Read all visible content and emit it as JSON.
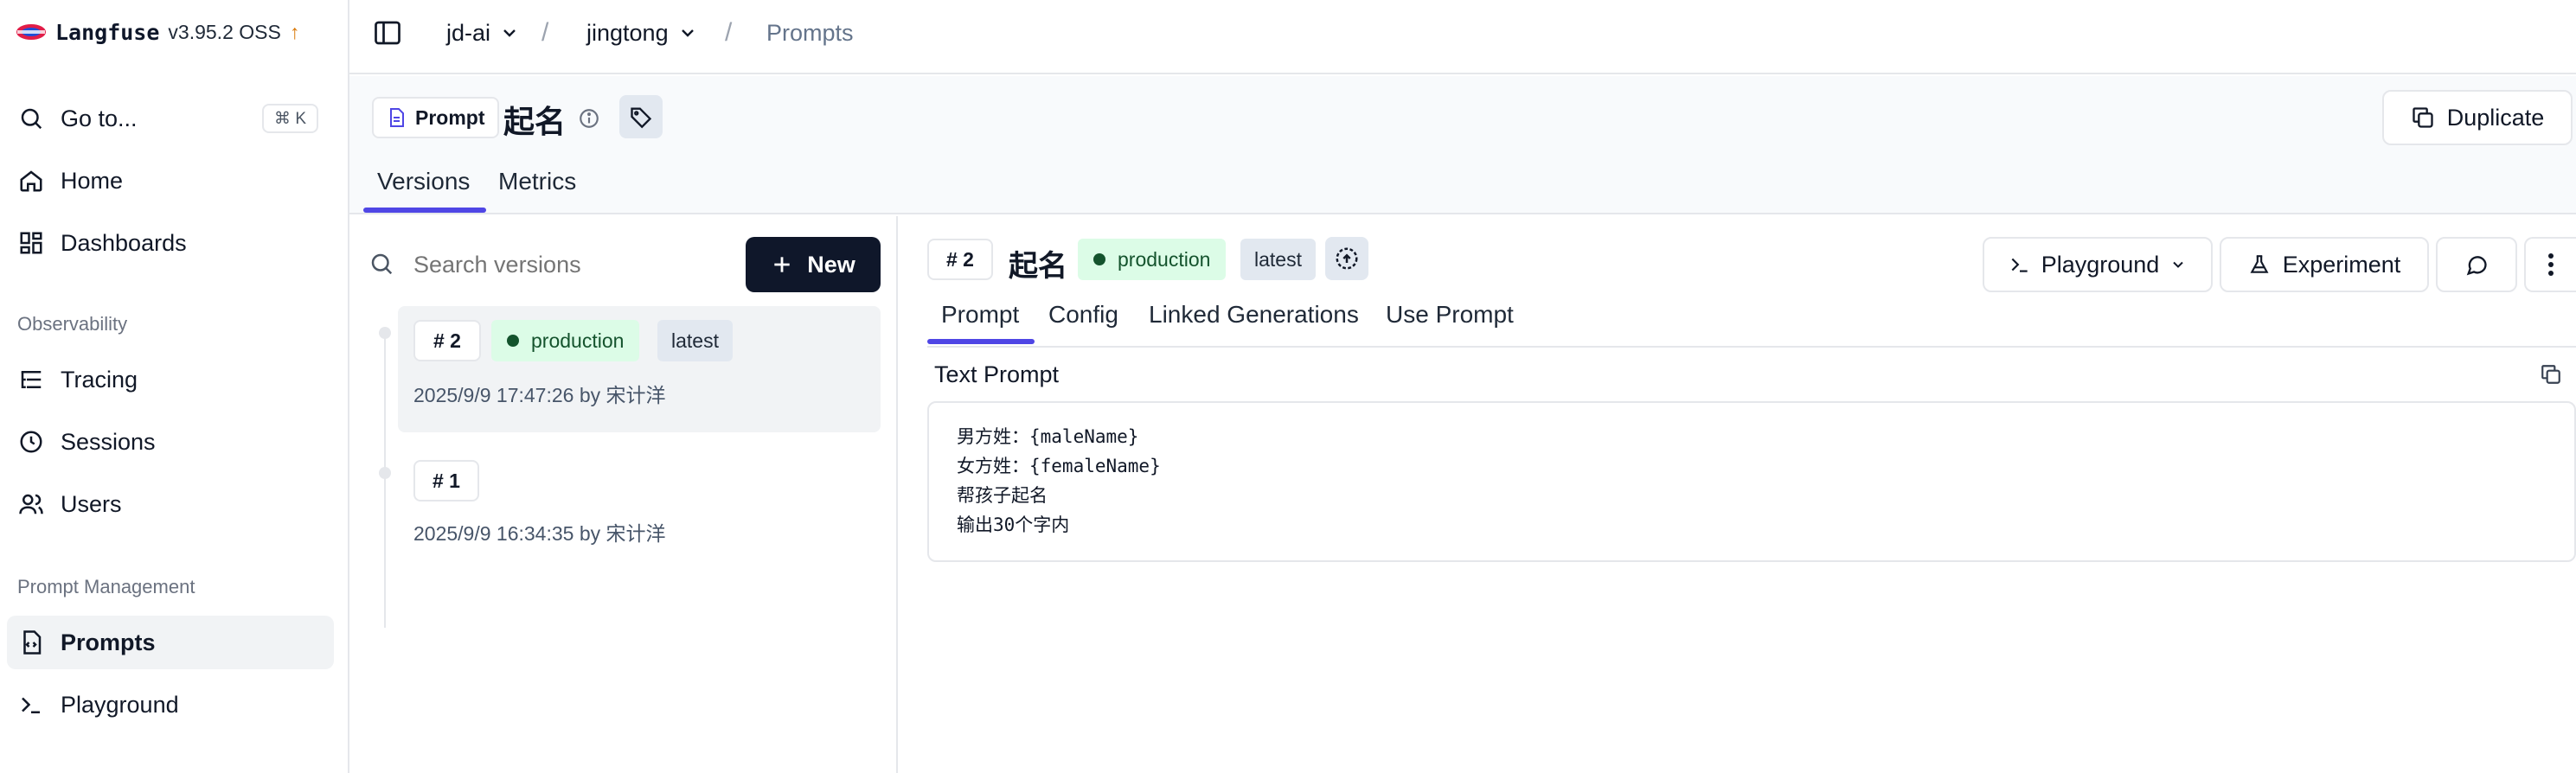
{
  "app": {
    "name": "Langfuse",
    "version": "v3.95.2 OSS",
    "update_glyph": "↑"
  },
  "sidebar": {
    "goto": {
      "label": "Go to...",
      "shortcut": "⌘ K",
      "icon": "search-icon"
    },
    "home": {
      "label": "Home",
      "icon": "home-icon"
    },
    "dashboards": {
      "label": "Dashboards",
      "icon": "dashboard-icon"
    },
    "observability_label": "Observability",
    "tracing": {
      "label": "Tracing",
      "icon": "tracing-icon"
    },
    "sessions": {
      "label": "Sessions",
      "icon": "clock-icon"
    },
    "users": {
      "label": "Users",
      "icon": "users-icon"
    },
    "prompt_mgmt_label": "Prompt Management",
    "prompts": {
      "label": "Prompts",
      "icon": "prompt-file-icon",
      "active": true
    },
    "playground": {
      "label": "Playground",
      "icon": "terminal-icon"
    }
  },
  "breadcrumb": {
    "org": "jd-ai",
    "project": "jingtong",
    "page": "Prompts",
    "separator": "/"
  },
  "header": {
    "type_badge": "Prompt",
    "title": "起名",
    "duplicate_label": "Duplicate",
    "tabs": [
      {
        "label": "Versions",
        "active": true
      },
      {
        "label": "Metrics",
        "active": false
      }
    ]
  },
  "versions": {
    "search_placeholder": "Search versions",
    "new_label": "New",
    "items": [
      {
        "num": "# 2",
        "labels": [
          "production",
          "latest"
        ],
        "meta": "2025/9/9 17:47:26 by 宋计洋",
        "selected": true
      },
      {
        "num": "# 1",
        "labels": [],
        "meta": "2025/9/9 16:34:35 by 宋计洋",
        "selected": false
      }
    ]
  },
  "detail": {
    "num": "# 2",
    "title": "起名",
    "labels": {
      "production": "production",
      "latest": "latest"
    },
    "playground_label": "Playground",
    "experiment_label": "Experiment",
    "tabs": [
      {
        "label": "Prompt",
        "active": true
      },
      {
        "label": "Config",
        "active": false
      },
      {
        "label": "Linked Generations",
        "active": false
      },
      {
        "label": "Use Prompt",
        "active": false
      }
    ],
    "section_title": "Text Prompt",
    "prompt_lines": [
      "男方姓：{maleName}",
      "女方姓：{femaleName}",
      "帮孩子起名",
      "输出30个字内"
    ]
  },
  "colors": {
    "accent": "#4f46e5",
    "primary_button": "#0f172a",
    "production_bg": "#dcfce7",
    "production_dot": "#14532d",
    "latest_bg": "#e2e8f0",
    "update_arrow": "#d97706"
  }
}
